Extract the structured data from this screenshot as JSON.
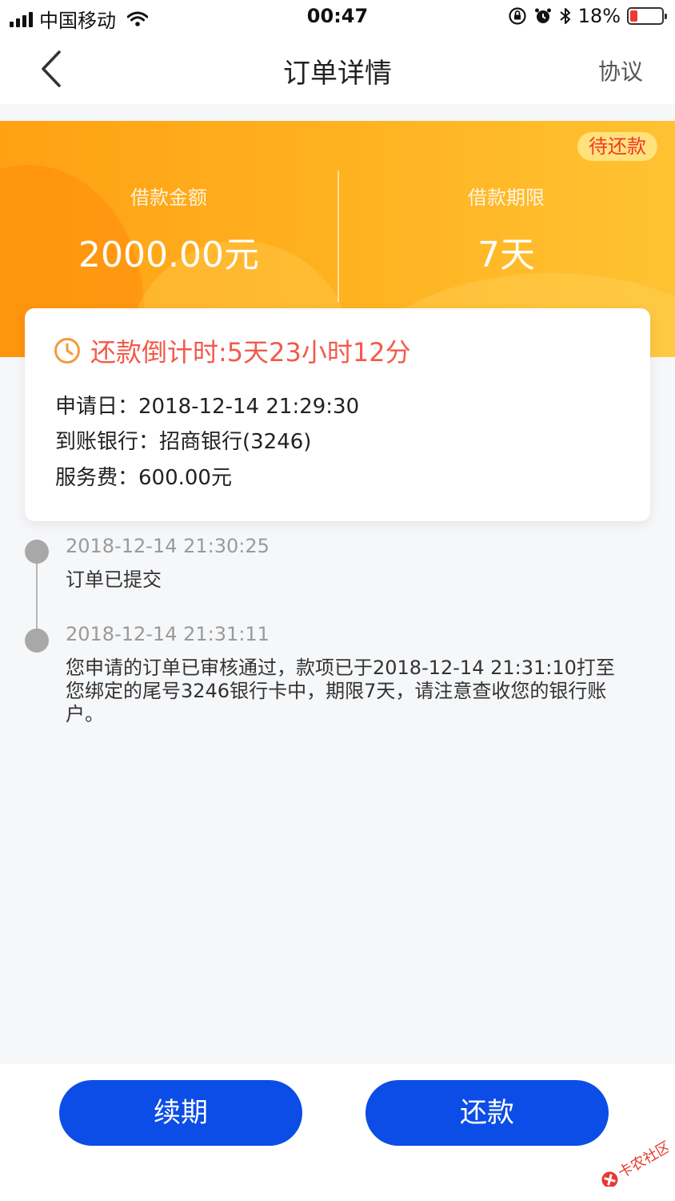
{
  "status_bar": {
    "carrier": "中国移动",
    "time": "00:47",
    "battery": "18%",
    "battery_level": 0.18
  },
  "nav": {
    "title": "订单详情",
    "right_link": "协议"
  },
  "banner": {
    "status_badge": "待还款",
    "amount_label": "借款金额",
    "amount_value": "2000.00元",
    "term_label": "借款期限",
    "term_value": "7天"
  },
  "card": {
    "countdown": "还款倒计时:5天23小时12分",
    "apply_date": "申请日：2018-12-14 21:29:30",
    "bank": "到账银行：招商银行(3246)",
    "service_fee": "服务费：600.00元"
  },
  "timeline": [
    {
      "time": "2018-12-14 21:30:25",
      "text": "订单已提交"
    },
    {
      "time": "2018-12-14 21:31:11",
      "text": "您申请的订单已审核通过，款项已于2018-12-14 21:31:10打至您绑定的尾号3246银行卡中，期限7天，请注意查收您的银行账户。"
    }
  ],
  "buttons": {
    "renew": "续期",
    "repay": "还款"
  },
  "watermark": {
    "text": "卡农社区"
  },
  "colors": {
    "accent_blue": "#0b4de6",
    "banner_orange": "#ffa113",
    "countdown_red": "#f25a4a",
    "badge_red": "#f0392c"
  }
}
